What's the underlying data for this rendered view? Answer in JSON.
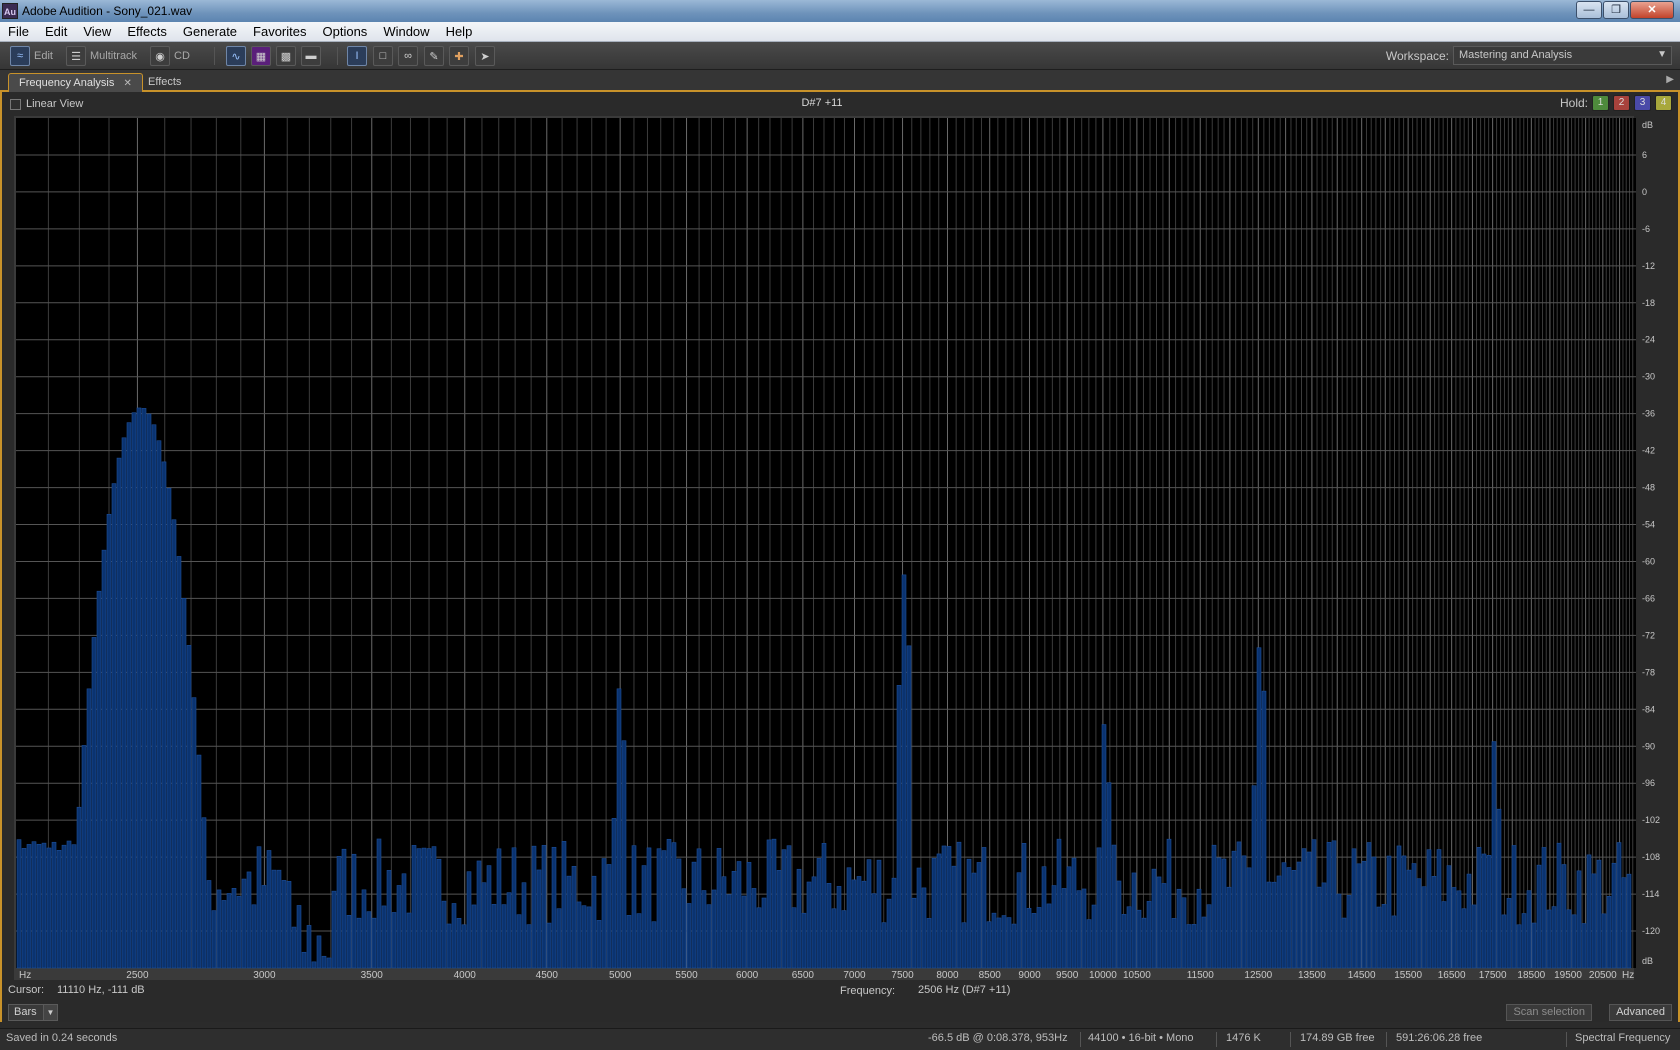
{
  "window": {
    "app_icon": "Au",
    "title": "Adobe Audition - Sony_021.wav"
  },
  "menu": [
    "File",
    "Edit",
    "View",
    "Effects",
    "Generate",
    "Favorites",
    "Options",
    "Window",
    "Help"
  ],
  "toolbar": {
    "edit_label": "Edit",
    "multitrack_label": "Multitrack",
    "cd_label": "CD",
    "workspace_label": "Workspace:",
    "workspace_value": "Mastering and Analysis"
  },
  "tabs": {
    "frequency_analysis": "Frequency Analysis",
    "effects": "Effects"
  },
  "panel": {
    "linear_view_label": "Linear View",
    "note_readout": "D#7 +11",
    "hold_label": "Hold:",
    "hold_buttons": [
      "1",
      "2",
      "3",
      "4"
    ],
    "hold_colors": [
      "#4e8a3c",
      "#a8423c",
      "#4a4aa8",
      "#a8a83c"
    ],
    "cursor_label": "Cursor:",
    "cursor_value": "11110 Hz,  -111 dB",
    "frequency_label": "Frequency:",
    "frequency_value": "2506 Hz (D#7 +11)",
    "display_mode": "Bars",
    "scan_selection_label": "Scan selection",
    "advanced_label": "Advanced"
  },
  "chart_data": {
    "type": "bar",
    "x_unit": "Hz",
    "y_unit": "dB",
    "x_scale": "log",
    "xlim": [
      2100,
      21500
    ],
    "ylim": [
      -126,
      12
    ],
    "x_ticks": [
      2500,
      3000,
      3500,
      4000,
      4500,
      5000,
      5500,
      6000,
      6500,
      7000,
      7500,
      8000,
      8500,
      9000,
      9500,
      10000,
      10500,
      11500,
      12500,
      13500,
      14500,
      15500,
      16500,
      17500,
      18500,
      19500,
      20500
    ],
    "y_ticks": [
      6,
      0,
      -6,
      -12,
      -18,
      -24,
      -30,
      -36,
      -42,
      -48,
      -54,
      -60,
      -66,
      -72,
      -78,
      -84,
      -90,
      -96,
      -102,
      -108,
      -114,
      -120
    ],
    "grid": true,
    "bar_color": "#0a3370",
    "peaks": [
      {
        "freq": 2506,
        "db": -35
      },
      {
        "freq": 4985,
        "db": -80
      },
      {
        "freq": 7500,
        "db": -62
      },
      {
        "freq": 10000,
        "db": -86
      },
      {
        "freq": 12500,
        "db": -73
      },
      {
        "freq": 17500,
        "db": -89
      }
    ],
    "floor_db": -112
  },
  "status": {
    "saved": "Saved in 0.24 seconds",
    "level": "-66.5 dB @  0:08.378, 953Hz",
    "format": "44100 • 16-bit • Mono",
    "size": "1476 K",
    "disk_free": "174.89 GB free",
    "time_free": "591:26:06.28 free",
    "view": "Spectral Frequency"
  }
}
